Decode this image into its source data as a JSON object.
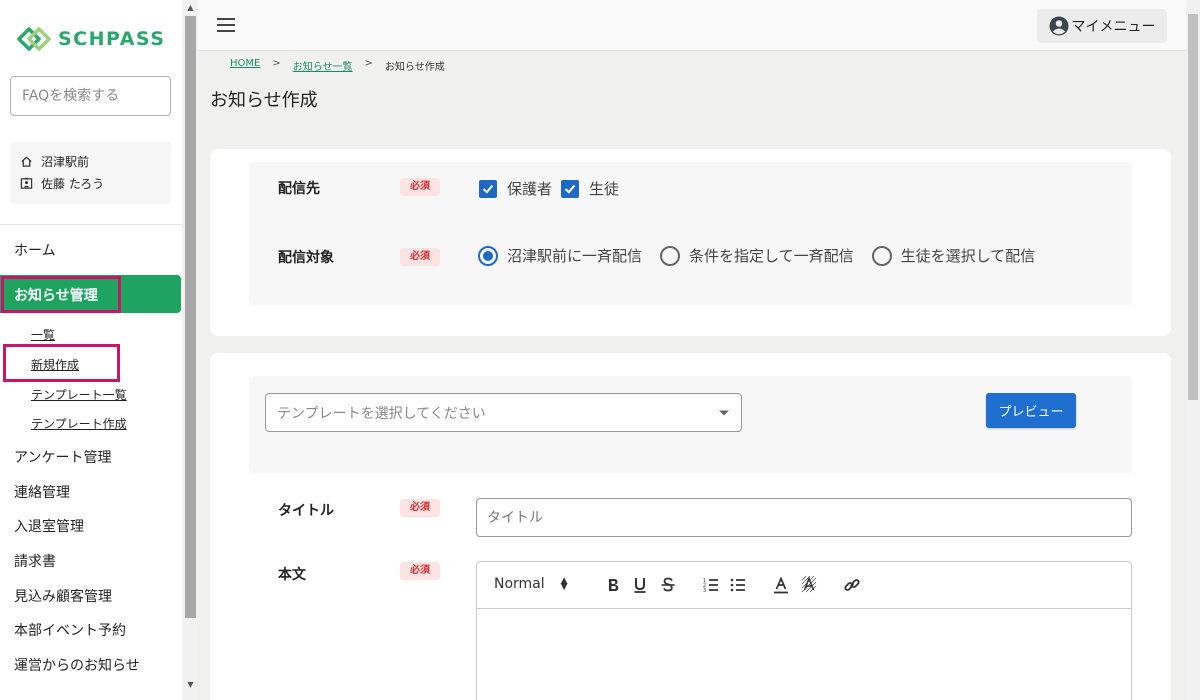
{
  "app": {
    "logo_text": "SCHPASS",
    "brand_color": "#1ea361"
  },
  "sidebar": {
    "faq_placeholder": "FAQを検索する",
    "school": "沼津駅前",
    "user_name": "佐藤 たろう",
    "nav": {
      "home": "ホーム",
      "news_mgmt": "お知らせ管理",
      "news_sub": [
        "一覧",
        "新規作成",
        "テンプレート一覧",
        "テンプレート作成"
      ],
      "survey": "アンケート管理",
      "contact": "連絡管理",
      "entry_exit": "入退室管理",
      "invoice": "請求書",
      "prospects": "見込み顧客管理",
      "hq_events": "本部イベント予約",
      "ops_news": "運営からのお知らせ"
    }
  },
  "header": {
    "my_menu": "マイメニュー"
  },
  "breadcrumb": {
    "home": "HOME",
    "list": "お知らせ一覧",
    "current": "お知らせ作成",
    "separator": ">"
  },
  "page": {
    "title": "お知らせ作成"
  },
  "form": {
    "required": "必須",
    "recipients": {
      "label": "配信先",
      "options": [
        "保護者",
        "生徒"
      ],
      "checked": [
        true,
        true
      ]
    },
    "target": {
      "label": "配信対象",
      "options": [
        "沼津駅前に一斉配信",
        "条件を指定して一斉配信",
        "生徒を選択して配信"
      ],
      "selected": "沼津駅前に一斉配信"
    },
    "template": {
      "placeholder": "テンプレートを選択してください",
      "preview_button": "プレビュー"
    },
    "title": {
      "label": "タイトル",
      "placeholder": "タイトル"
    },
    "body": {
      "label": "本文",
      "format": "Normal",
      "toolbar_icons": [
        "bold-icon",
        "underline-icon",
        "strikethrough-icon",
        "ordered-list-icon",
        "bullet-list-icon",
        "text-color-icon",
        "background-color-icon",
        "link-icon"
      ]
    }
  }
}
